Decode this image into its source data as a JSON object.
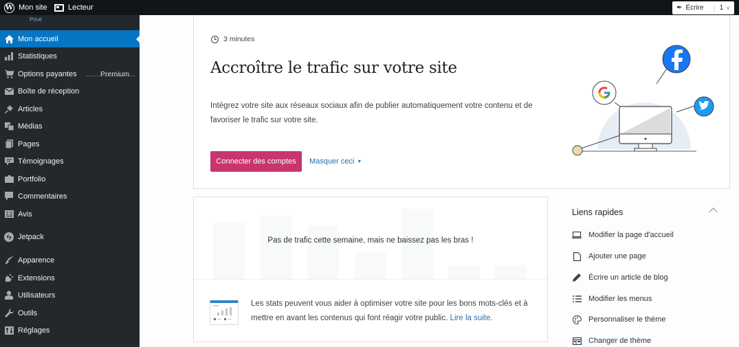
{
  "topbar": {
    "site_label": "Mon site",
    "site_status": "Privé",
    "reader_label": "Lecteur",
    "write_label": "Écrire",
    "notifications_count": "1"
  },
  "sidebar": {
    "items": [
      {
        "label": "Mon accueil",
        "icon": "home-icon",
        "active": true
      },
      {
        "label": "Statistiques",
        "icon": "stats-icon"
      },
      {
        "label": "Options payantes",
        "icon": "cart-icon",
        "badge": "Premium"
      },
      {
        "label": "Boîte de réception",
        "icon": "mail-icon"
      },
      {
        "label": "Articles",
        "icon": "pin-icon"
      },
      {
        "label": "Médias",
        "icon": "media-icon"
      },
      {
        "label": "Pages",
        "icon": "page-icon"
      },
      {
        "label": "Témoignages",
        "icon": "testimonial-icon"
      },
      {
        "label": "Portfolio",
        "icon": "portfolio-icon"
      },
      {
        "label": "Commentaires",
        "icon": "comment-icon"
      },
      {
        "label": "Avis",
        "icon": "feedback-icon"
      },
      {
        "label": "Jetpack",
        "icon": "jetpack-icon"
      },
      {
        "label": "Apparence",
        "icon": "brush-icon"
      },
      {
        "label": "Extensions",
        "icon": "plugin-icon"
      },
      {
        "label": "Utilisateurs",
        "icon": "user-icon"
      },
      {
        "label": "Outils",
        "icon": "wrench-icon"
      },
      {
        "label": "Réglages",
        "icon": "settings-icon"
      }
    ]
  },
  "task_card": {
    "duration": "3 minutes",
    "title": "Accroître le trafic sur votre site",
    "description": "Intégrez votre site aux réseaux sociaux afin de publier automatiquement votre contenu et de favoriser le trafic sur votre site.",
    "primary_button": "Connecter des comptes",
    "dismiss_link": "Masquer ceci",
    "colors": {
      "primary": "#c9356e",
      "facebook": "#1877f2",
      "twitter": "#1d9bf0"
    }
  },
  "stats_card": {
    "empty_message": "Pas de trafic cette semaine, mais ne baissez pas les bras !",
    "tip_text": "Les stats peuvent vous aider à optimiser votre site pour les bons mots-clés et à mettre en avant les contenus qui font réagir votre public. ",
    "tip_link": "Lire la suite."
  },
  "quick_links": {
    "title": "Liens rapides",
    "items": [
      {
        "label": "Modifier la page d'accueil",
        "icon": "laptop-icon"
      },
      {
        "label": "Ajouter une page",
        "icon": "page-icon"
      },
      {
        "label": "Écrire un article de blog",
        "icon": "pencil-icon"
      },
      {
        "label": "Modifier les menus",
        "icon": "list-icon"
      },
      {
        "label": "Personnaliser le thème",
        "icon": "palette-icon"
      },
      {
        "label": "Changer de thème",
        "icon": "theme-icon"
      }
    ]
  }
}
